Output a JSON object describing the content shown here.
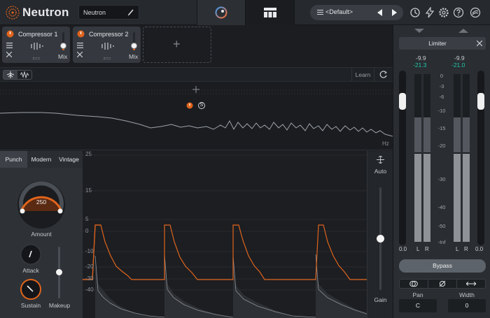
{
  "app": {
    "title": "Neutron",
    "instance_name": "Neutron",
    "preset": "<Default>"
  },
  "toolbar": {
    "icons": [
      "history-icon",
      "assistant-icon",
      "settings-icon",
      "help-icon",
      "relay-icon"
    ]
  },
  "modules": [
    {
      "name": "Compressor 1",
      "mix_label": "Mix",
      "mix_level": 0.3
    },
    {
      "name": "Compressor 2",
      "mix_label": "Mix",
      "mix_level": 0.3
    }
  ],
  "spectrum": {
    "learn_label": "Learn",
    "hz_label": "Hz",
    "band_badge": "S"
  },
  "transient": {
    "styles": [
      "Punch",
      "Modern",
      "Vintage"
    ],
    "active_style": "Punch",
    "amount_value": "250",
    "amount_label": "Amount",
    "attack_label": "Attack",
    "sustain_label": "Sustain",
    "makeup_label": "Makeup",
    "db_ticks": [
      "25",
      "15",
      "5",
      "0",
      "-10",
      "-20",
      "-30",
      "-40"
    ],
    "gain_label": "Gain",
    "auto_label": "Auto"
  },
  "limiter": {
    "name": "Limiter",
    "input_peak_a": "-9.9",
    "input_peak_b": "-21.3",
    "output_peak_a": "-9.9",
    "output_peak_b": "-21.0",
    "scale": [
      "0",
      "-3",
      "-6",
      "-10",
      "-15",
      "-20",
      "-30",
      "-40",
      "-50",
      "-Inf"
    ],
    "in_value": "0.0",
    "out_value": "0.0",
    "l_label": "L",
    "r_label": "R",
    "bypass_label": "Bypass",
    "pan_label": "Pan",
    "width_label": "Width",
    "pan_value": "C",
    "width_value": "0"
  },
  "colors": {
    "accent": "#e0641c",
    "meter_teal": "#1ec8a7",
    "background": "#1c1f23"
  }
}
